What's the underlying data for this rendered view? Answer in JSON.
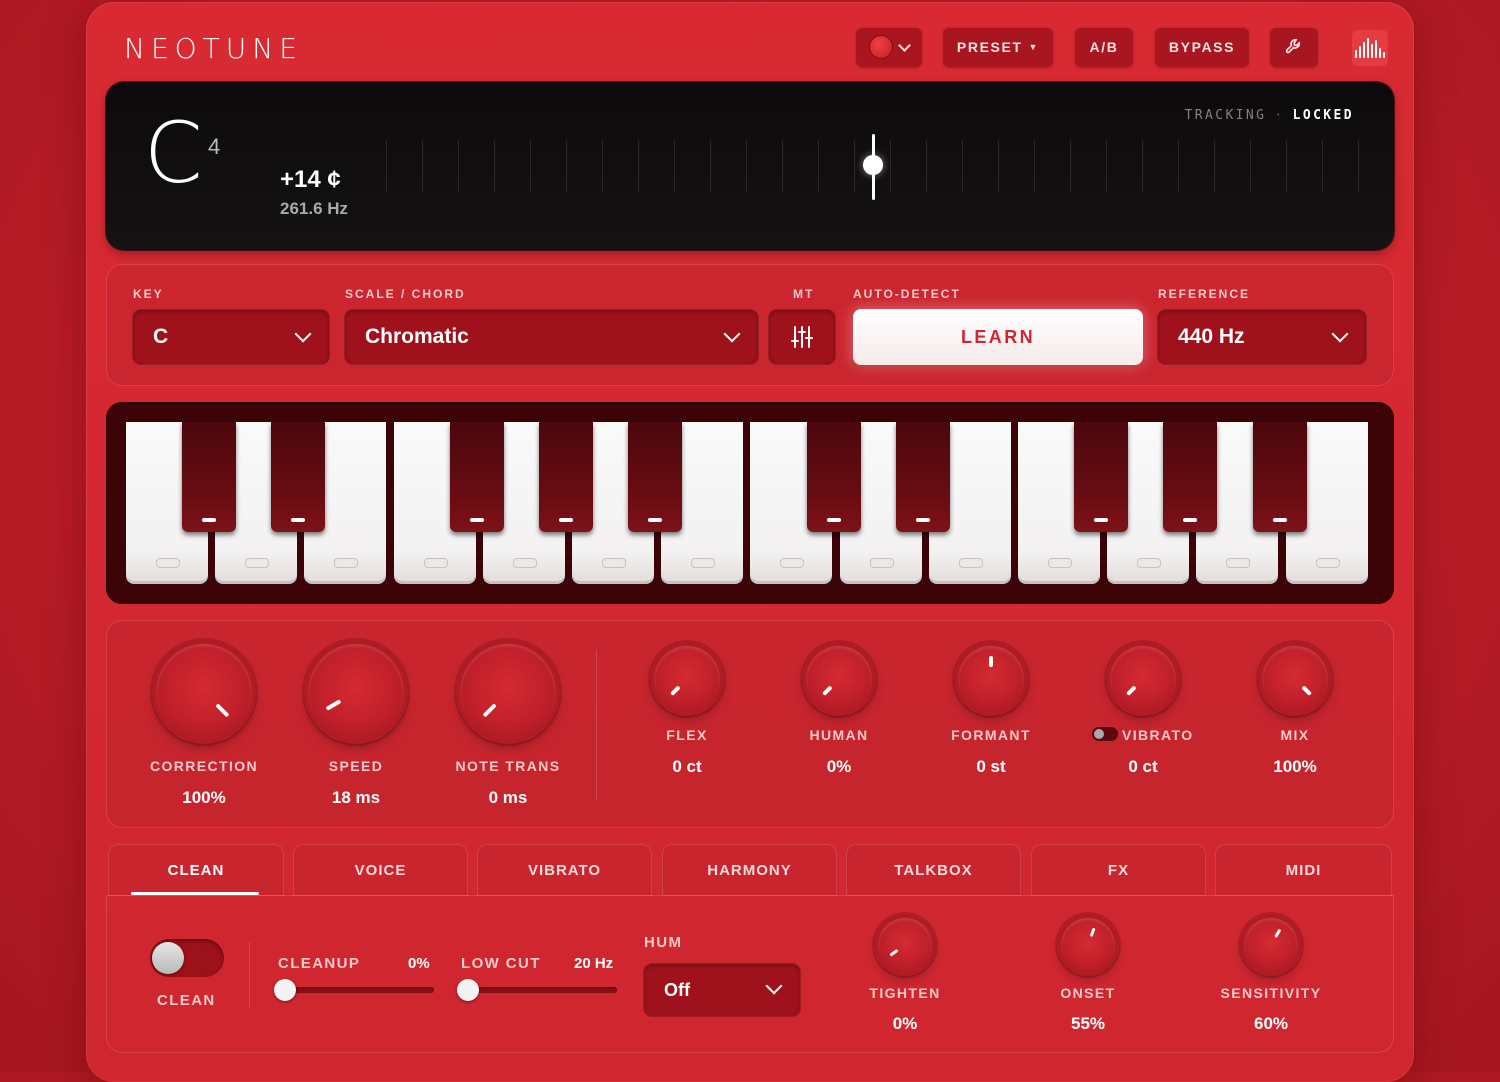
{
  "header": {
    "logo": "NEOTUNE",
    "preset_label": "PRESET",
    "ab_label": "A/B",
    "bypass_label": "BYPASS"
  },
  "tuner": {
    "note": "C",
    "octave": "4",
    "cents": "+14 ¢",
    "frequency": "261.6 Hz",
    "tracking_label": "TRACKING",
    "tracking_separator": "·",
    "tracking_state": "LOCKED"
  },
  "controls": {
    "key_label": "KEY",
    "key_value": "C",
    "scale_label": "SCALE / CHORD",
    "scale_value": "Chromatic",
    "mt_label": "MT",
    "autodetect_label": "AUTO-DETECT",
    "learn_label": "LEARN",
    "reference_label": "REFERENCE",
    "reference_value": "440 Hz"
  },
  "knobs": {
    "correction": {
      "label": "CORRECTION",
      "value": "100%"
    },
    "speed": {
      "label": "SPEED",
      "value": "18 ms"
    },
    "note_trans": {
      "label": "NOTE TRANS",
      "value": "0 ms"
    },
    "flex": {
      "label": "FLEX",
      "value": "0 ct"
    },
    "human": {
      "label": "HUMAN",
      "value": "0%"
    },
    "formant": {
      "label": "FORMANT",
      "value": "0 st"
    },
    "vibrato": {
      "label": "VIBRATO",
      "value": "0 ct"
    },
    "mix": {
      "label": "MIX",
      "value": "100%"
    }
  },
  "tabs": [
    "CLEAN",
    "VOICE",
    "VIBRATO",
    "HARMONY",
    "TALKBOX",
    "FX",
    "MIDI"
  ],
  "clean_panel": {
    "toggle_label": "CLEAN",
    "cleanup_label": "CLEANUP",
    "cleanup_value": "0%",
    "cleanup_level": 0,
    "lowcut_label": "LOW CUT",
    "lowcut_value": "20 Hz",
    "lowcut_level": 0,
    "hum_label": "HUM",
    "hum_value": "Off",
    "tighten": {
      "label": "TIGHTEN",
      "value": "0%"
    },
    "onset": {
      "label": "ONSET",
      "value": "55%"
    },
    "sensitivity": {
      "label": "SENSITIVITY",
      "value": "60%"
    }
  },
  "colors": {
    "background": "#b81c26",
    "panel": "#d92a33",
    "control_dark": "#a0121b",
    "learn_text": "#d1262f"
  },
  "icons": {
    "record": "record-dot-icon",
    "settings": "wrench-icon",
    "meter": "level-meter-icon",
    "mt": "sliders-icon"
  }
}
